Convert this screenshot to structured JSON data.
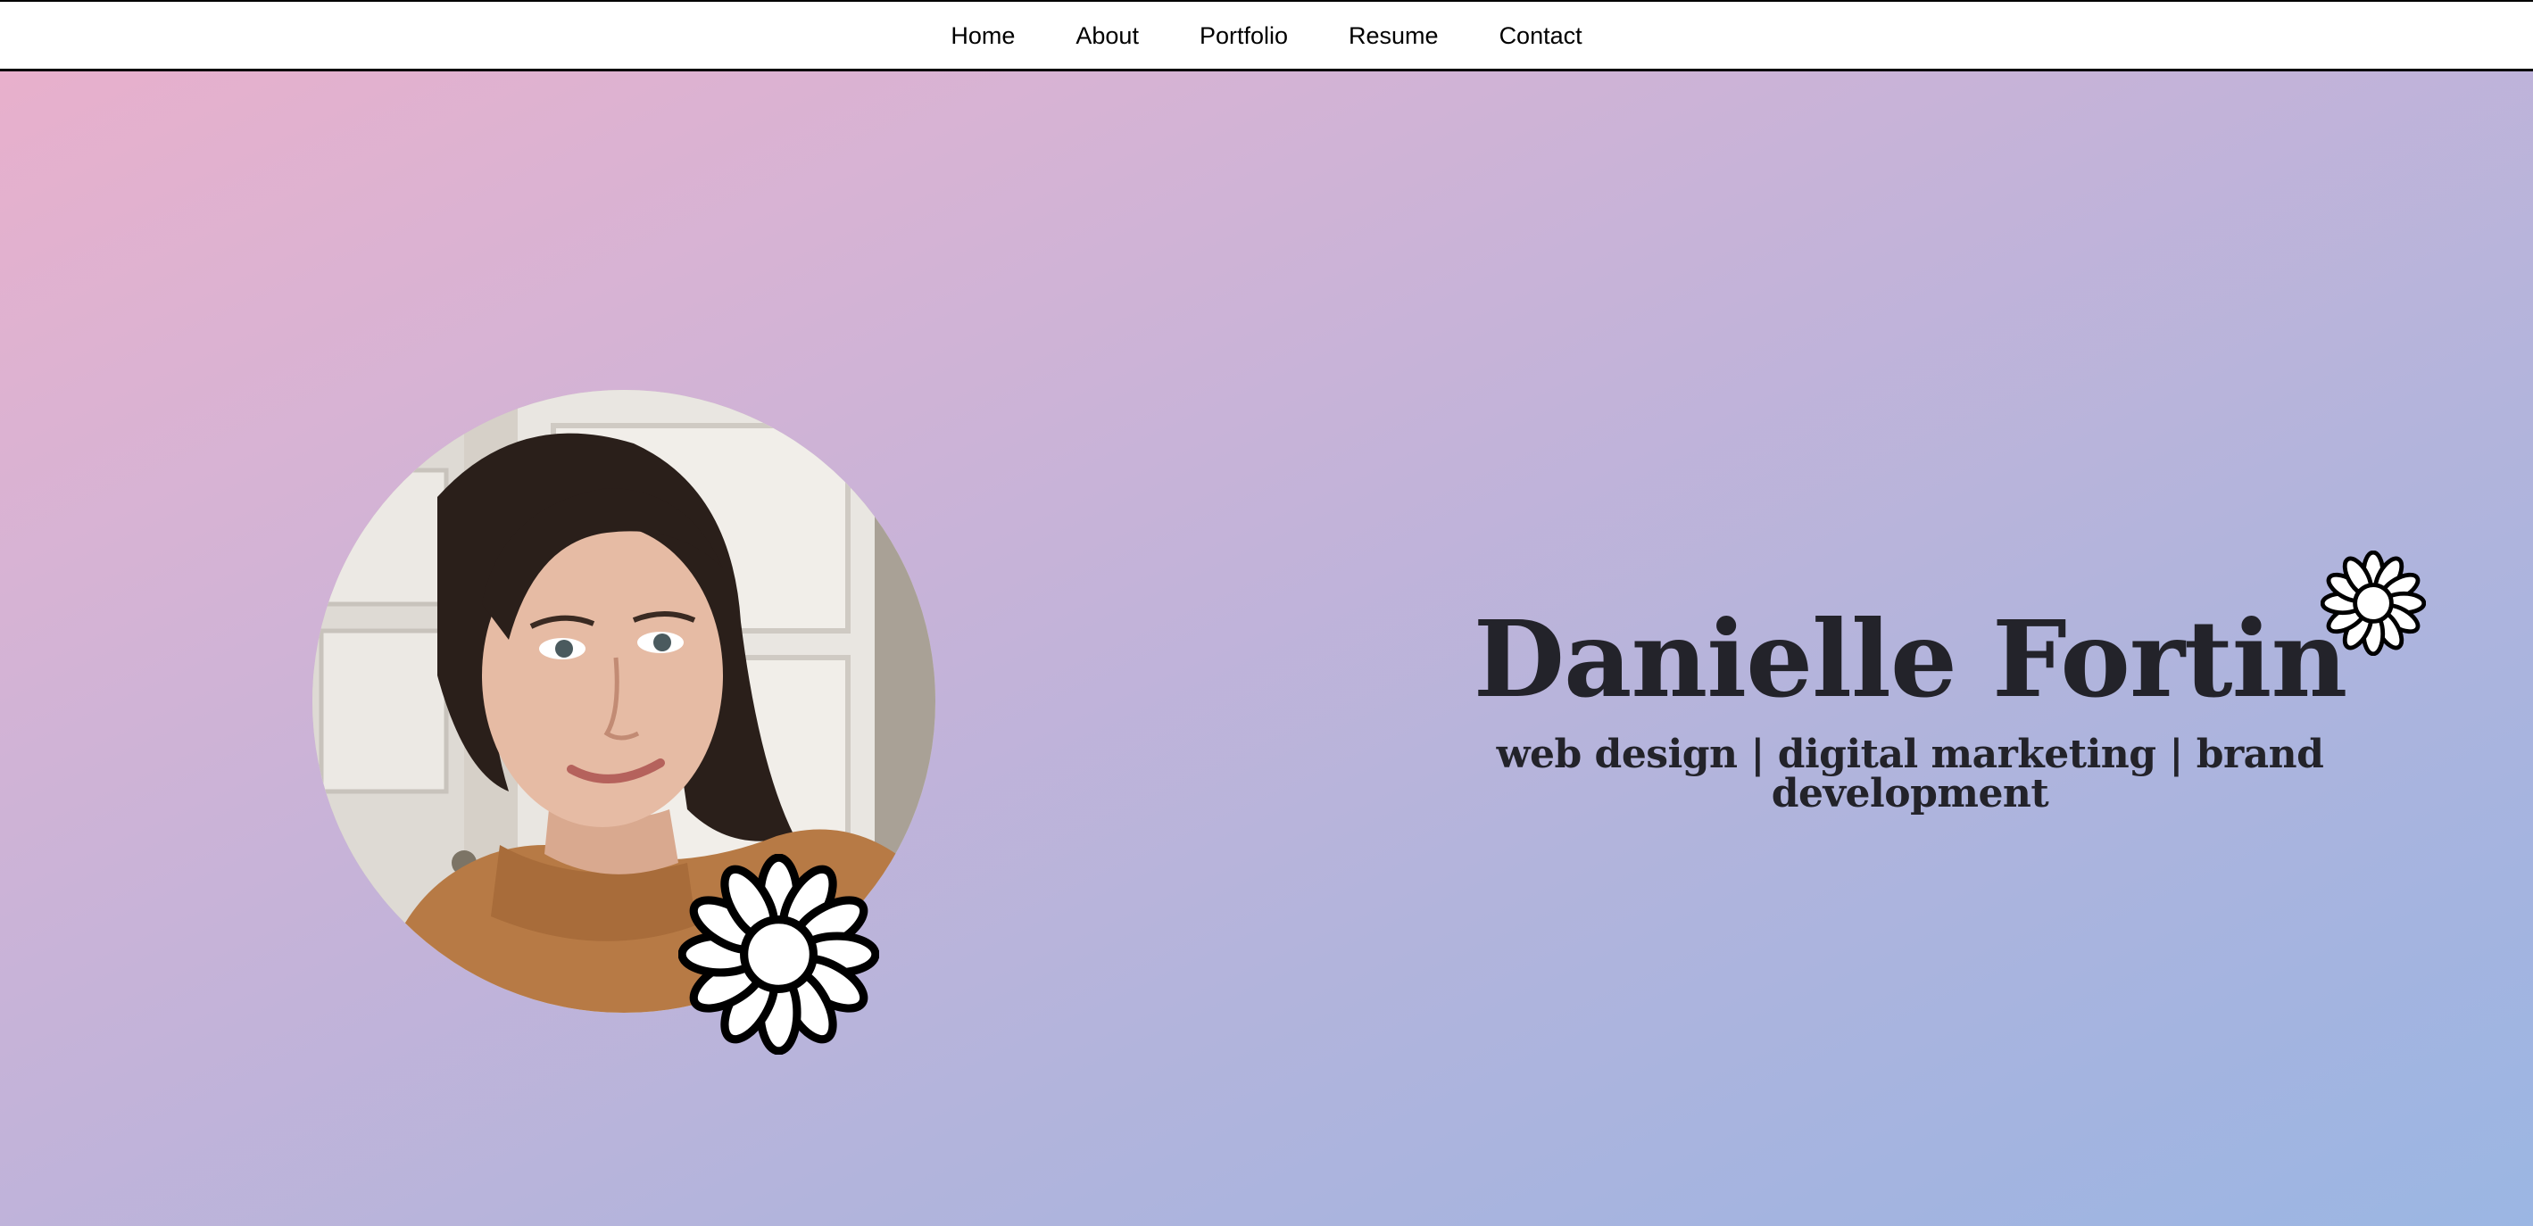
{
  "nav": {
    "items": [
      {
        "label": "Home"
      },
      {
        "label": "About"
      },
      {
        "label": "Portfolio"
      },
      {
        "label": "Resume"
      },
      {
        "label": "Contact"
      }
    ]
  },
  "hero": {
    "name": "Danielle Fortin",
    "tagline": "web design | digital marketing | brand development",
    "gradient_colors": [
      "#e8b0cc",
      "#c3b3d9",
      "#9bb6e3"
    ],
    "text_color": "#23232a"
  },
  "icons": {
    "daisy": "daisy-flower-icon"
  }
}
